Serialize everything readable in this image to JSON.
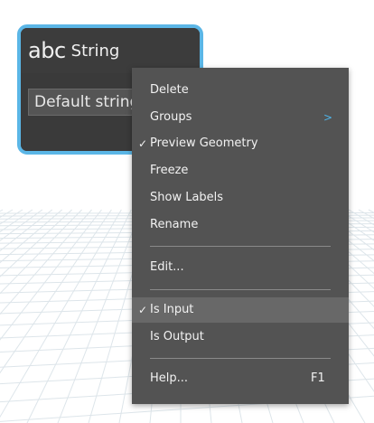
{
  "node": {
    "icon_text": "abc",
    "title": "String",
    "input_value": "Default string"
  },
  "menu": {
    "items": [
      {
        "label": "Delete"
      },
      {
        "label": "Groups",
        "submenu": true
      },
      {
        "label": "Preview Geometry",
        "checked": true
      },
      {
        "label": "Freeze"
      },
      {
        "label": "Show Labels"
      },
      {
        "label": "Rename"
      },
      {
        "label": "Edit..."
      },
      {
        "label": "Is Input",
        "checked": true,
        "highlighted": true
      },
      {
        "label": "Is Output"
      },
      {
        "label": "Help...",
        "shortcut": "F1"
      }
    ],
    "check_glyph": "✓",
    "submenu_glyph": ">"
  },
  "colors": {
    "node_border": "#5bb6e6",
    "node_bg": "#3c3c3c",
    "menu_bg": "#535353",
    "menu_highlight": "#686868",
    "submenu_arrow": "#4fb4e8"
  }
}
